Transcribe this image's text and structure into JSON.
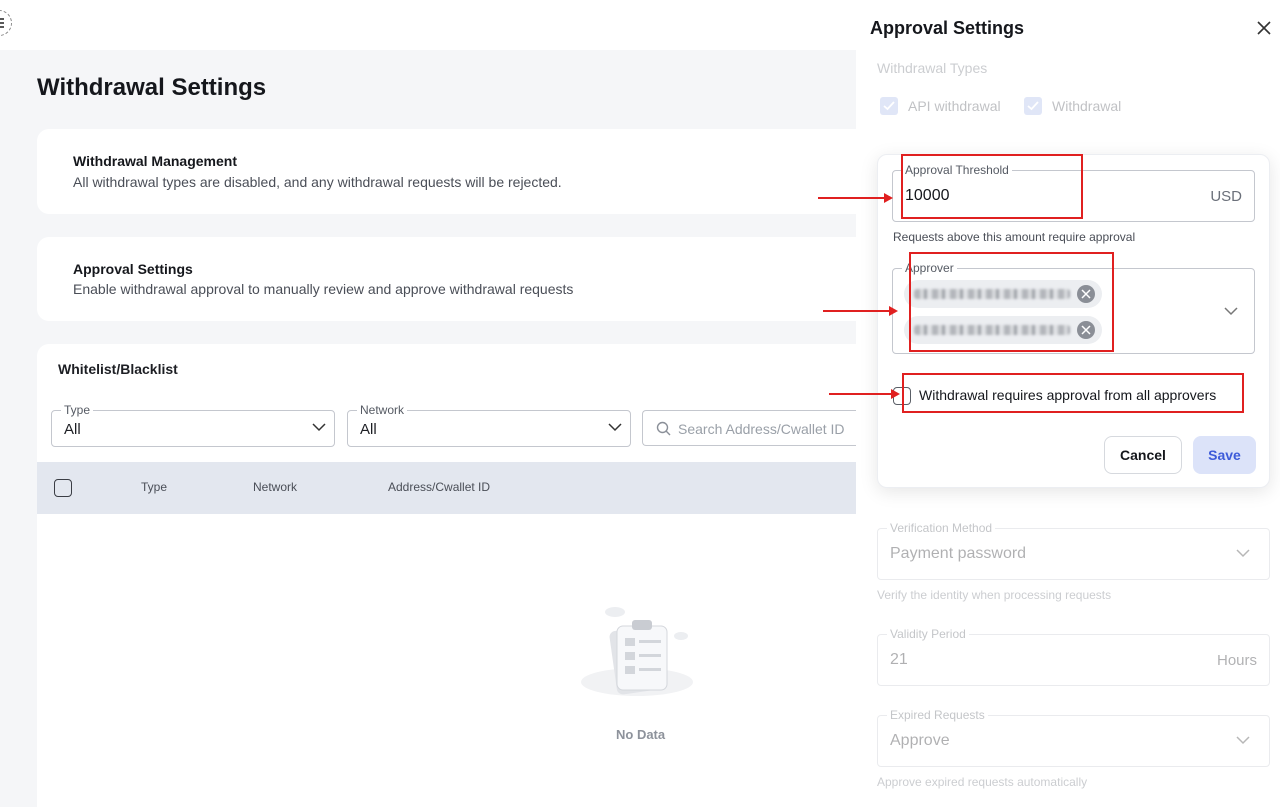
{
  "page": {
    "title": "Withdrawal Settings"
  },
  "cards": {
    "management": {
      "title": "Withdrawal Management",
      "desc": "All withdrawal types are disabled, and any withdrawal requests will be rejected."
    },
    "approval": {
      "title": "Approval Settings",
      "desc": "Enable withdrawal approval to manually review and approve withdrawal requests"
    }
  },
  "list": {
    "title": "Whitelist/Blacklist",
    "type_filter": {
      "label": "Type",
      "value": "All"
    },
    "network_filter": {
      "label": "Network",
      "value": "All"
    },
    "search_placeholder": "Search Address/Cwallet ID",
    "columns": [
      "Type",
      "Network",
      "Address/Cwallet ID"
    ],
    "empty_text": "No Data"
  },
  "drawer": {
    "title": "Approval Settings",
    "withdrawal_types_label": "Withdrawal Types",
    "types": [
      "API withdrawal",
      "Withdrawal"
    ],
    "verification": {
      "label": "Verification Method",
      "value": "Payment password",
      "hint": "Verify the identity when processing requests"
    },
    "validity": {
      "label": "Validity Period",
      "value": "21",
      "unit": "Hours"
    },
    "expired": {
      "label": "Expired Requests",
      "value": "Approve",
      "hint": "Approve expired requests automatically"
    }
  },
  "popup": {
    "threshold": {
      "label": "Approval Threshold",
      "value": "10000",
      "unit": "USD",
      "hint": "Requests above this amount require approval"
    },
    "approver": {
      "label": "Approver"
    },
    "all_approvers_label": "Withdrawal requires approval from all approvers",
    "cancel_label": "Cancel",
    "save_label": "Save"
  },
  "colors": {
    "accent": "#3d5bd9",
    "annotation": "#e02020"
  }
}
